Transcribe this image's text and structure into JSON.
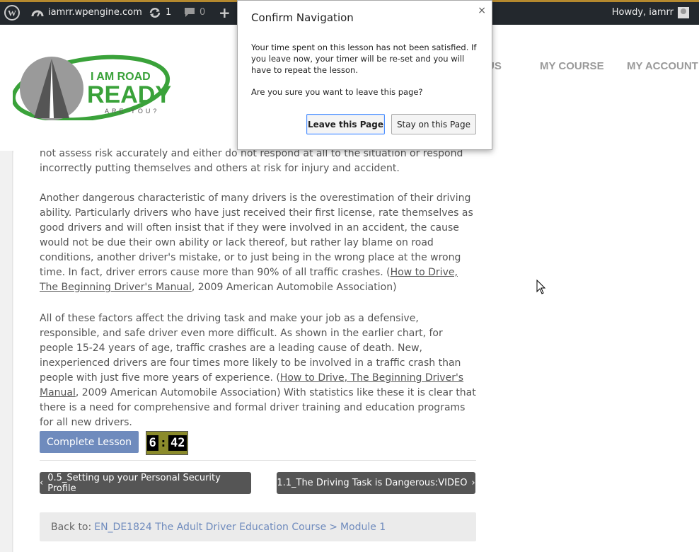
{
  "adminbar": {
    "site": "iamrr.wpengine.com",
    "updates_count": "1",
    "comments_count": "0",
    "new_label": "+",
    "howdy": "Howdy, iamrr"
  },
  "logo": {
    "line1": "I AM ROAD",
    "line2": "READY",
    "line3": "ARE YOU?"
  },
  "nav": {
    "items": [
      "US",
      "MY COURSE",
      "MY ACCOUNT"
    ]
  },
  "content": {
    "p0": "not assess risk accurately and either do not respond at all to the situation or respond incorrectly putting themselves and others at risk for injury and accident.",
    "p1_a": "Another dangerous characteristic of many drivers is the overestimation of their driving ability. Particularly drivers who have just received their first license, rate themselves as good drivers and will often insist that if they were involved in an accident, the cause would not be due their own ability or lack thereof, but rather lay blame on road conditions, another driver's mistake, or to just being in the wrong place at the wrong time. In fact, driver errors cause more than 90% of all traffic crashes. (",
    "p1_link": "How to Drive, The Beginning Driver's Manual",
    "p1_b": ", 2009 American Automobile Association)",
    "p2_a": "All of these factors affect the driving task and make your job as a defensive, responsible, and safe driver even more difficult. As shown in the earlier chart, for people 15-24 years of age, traffic crashes are a leading cause of death. New, inexperienced drivers are four times more likely to be involved in a traffic crash than people with just five more years of experience. (",
    "p2_link": "How to Drive, The Beginning Driver's Manual",
    "p2_b": ", 2009 American Automobile Association) With statistics like these it is clear that there is a need for comprehensive and formal driver training and education programs for all new drivers."
  },
  "complete_button": "Complete Lesson",
  "timer": {
    "minutes": "6",
    "separator": ":",
    "seconds": "42"
  },
  "prev_lesson": "0.5_Setting up your Personal Security Profile",
  "next_lesson": "1.1_The Driving Task is Dangerous:VIDEO",
  "back_to": {
    "label": "Back to:",
    "course": "EN_DE1824 The Adult Driver Education Course",
    "separator": ">",
    "module": "Module 1"
  },
  "dialog": {
    "title": "Confirm Navigation",
    "close": "×",
    "message": "Your time spent on this lesson has not been satisfied. If you leave now, your timer will be re-set and you will have to repeat the lesson.",
    "question": "Are you sure you want to leave this page?",
    "leave_button": "Leave this Page",
    "stay_button": "Stay on this Page"
  },
  "colors": {
    "adminbar": "#23282d",
    "accent": "#6f8bbd",
    "logo_green": "#3aa23a",
    "timer_bg": "#8b8b2b"
  }
}
